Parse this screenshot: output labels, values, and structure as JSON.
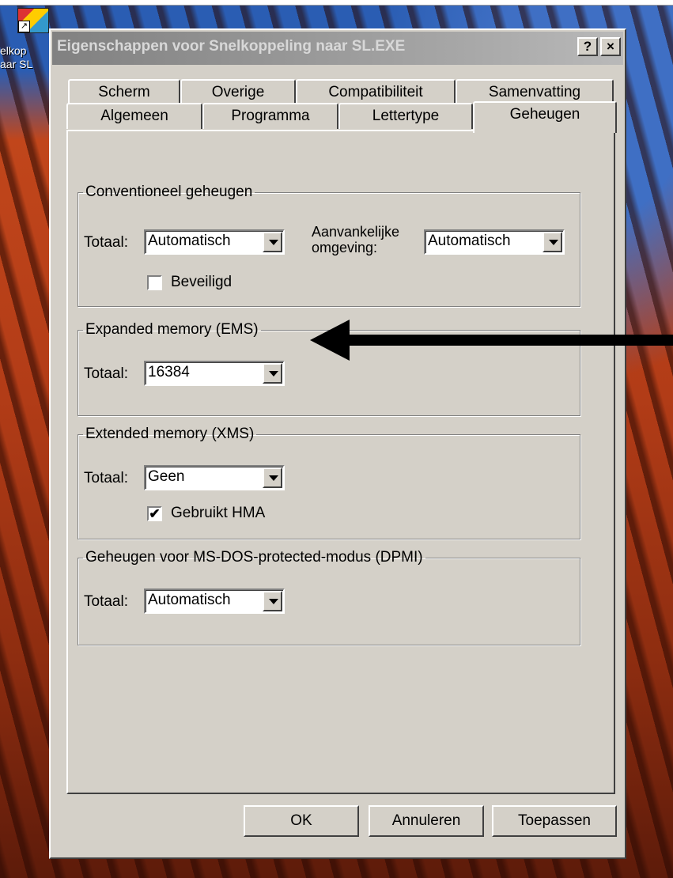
{
  "topbar": {
    "text_a": "...",
    "text_b": "..."
  },
  "desktop": {
    "icon_label_line1": "elkop",
    "icon_label_line2": "aar SL"
  },
  "window": {
    "title": "Eigenschappen voor Snelkoppeling naar SL.EXE",
    "help_label": "?",
    "close_label": "×"
  },
  "tabs": {
    "row1": [
      "Scherm",
      "Overige",
      "Compatibiliteit",
      "Samenvatting"
    ],
    "row2": [
      "Algemeen",
      "Programma",
      "Lettertype",
      "Geheugen"
    ],
    "active": "Geheugen"
  },
  "conventional": {
    "legend": "Conventioneel geheugen",
    "total_label": "Totaal:",
    "total_value": "Automatisch",
    "env_label_line1": "Aanvankelijke",
    "env_label_line2": "omgeving:",
    "env_value": "Automatisch",
    "protected_label": "Beveiligd",
    "protected_checked": false
  },
  "ems": {
    "legend": "Expanded memory (EMS)",
    "total_label": "Totaal:",
    "total_value": "16384"
  },
  "xms": {
    "legend": "Extended memory (XMS)",
    "total_label": "Totaal:",
    "total_value": "Geen",
    "hma_label": "Gebruikt HMA",
    "hma_checked": true,
    "hma_mark": "✔"
  },
  "dpmi": {
    "legend": "Geheugen voor MS-DOS-protected-modus (DPMI)",
    "total_label": "Totaal:",
    "total_value": "Automatisch"
  },
  "buttons": {
    "ok": "OK",
    "cancel": "Annuleren",
    "apply": "Toepassen"
  }
}
